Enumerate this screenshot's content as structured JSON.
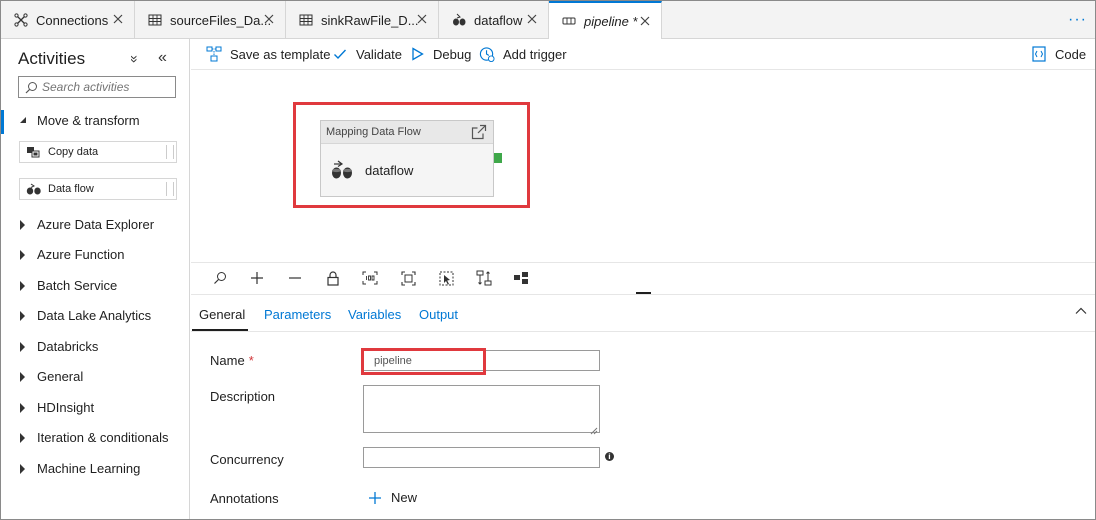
{
  "tabs": [
    {
      "label": "Connections",
      "icon": "connections-icon"
    },
    {
      "label": "sourceFiles_Da...",
      "icon": "dataset-table-icon"
    },
    {
      "label": "sinkRawFile_D...",
      "icon": "dataset-table-icon"
    },
    {
      "label": "dataflow",
      "icon": "dataflow-icon"
    },
    {
      "label": "pipeline *",
      "icon": "pipeline-icon",
      "active": true
    }
  ],
  "tab_more": "···",
  "sidebar": {
    "title": "Activities",
    "collapse_glyph": "»",
    "hide_glyph": "«",
    "search_placeholder": "Search activities",
    "expanded_category": "Move & transform",
    "activities": [
      "Copy data",
      "Data flow"
    ],
    "categories": [
      "Azure Data Explorer",
      "Azure Function",
      "Batch Service",
      "Data Lake Analytics",
      "Databricks",
      "General",
      "HDInsight",
      "Iteration & conditionals",
      "Machine Learning"
    ]
  },
  "toolbar": {
    "save_template": "Save as template",
    "validate": "Validate",
    "debug": "Debug",
    "add_trigger": "Add trigger",
    "code": "Code"
  },
  "canvas": {
    "node_type": "Mapping Data Flow",
    "node_name": "dataflow"
  },
  "properties": {
    "tabs": [
      "General",
      "Parameters",
      "Variables",
      "Output"
    ],
    "active_tab": "General",
    "name_label": "Name",
    "required_marker": "*",
    "name_value": "pipeline",
    "description_label": "Description",
    "concurrency_label": "Concurrency",
    "annotations_label": "Annotations",
    "new_label": "New",
    "info_glyph": "i"
  },
  "colors": {
    "accent": "#0078d4",
    "highlight": "#e0393e",
    "port": "#3fa84a"
  }
}
